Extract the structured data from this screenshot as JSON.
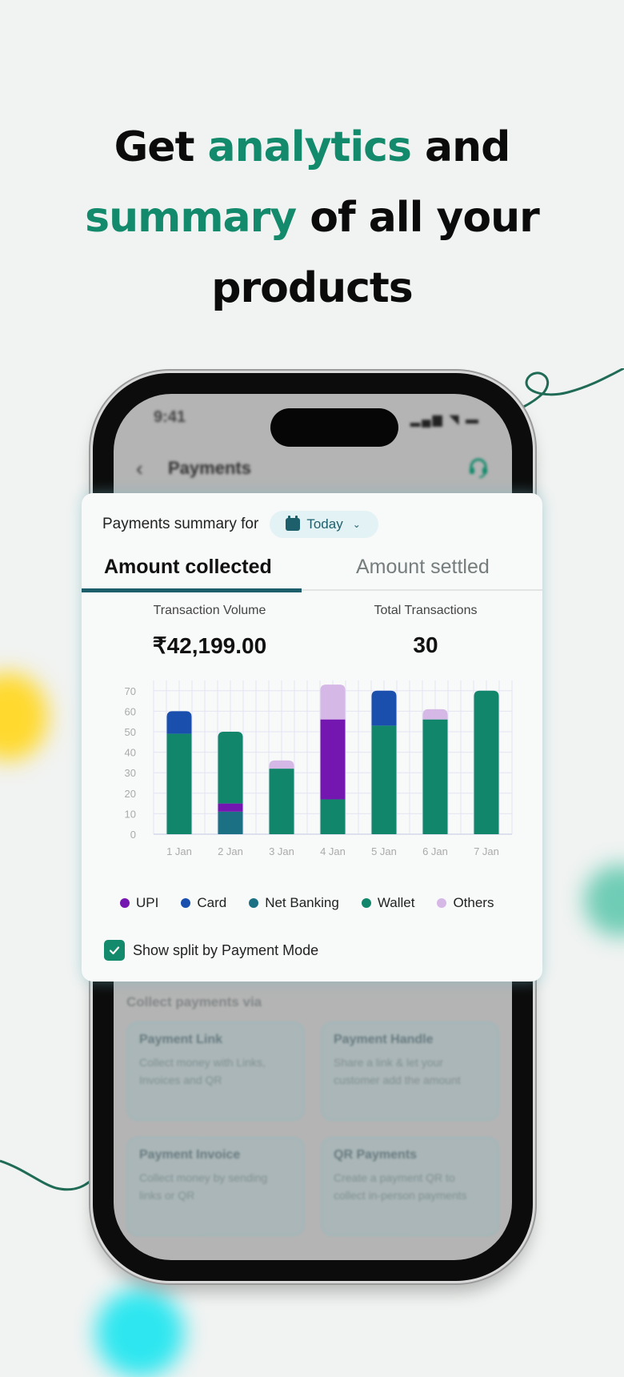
{
  "headline": {
    "line1": [
      {
        "text": "Get ",
        "accent": false
      },
      {
        "text": "analytics",
        "accent": true
      },
      {
        "text": " and",
        "accent": false
      }
    ],
    "line2": [
      {
        "text": "summary",
        "accent": true
      },
      {
        "text": " of all your",
        "accent": false
      }
    ],
    "line3": [
      {
        "text": "products",
        "accent": false
      }
    ]
  },
  "colors": {
    "accent": "#128a6b",
    "primary_dark": "#1c5f6b",
    "upi": "#7416b0",
    "card": "#1a4fae",
    "net_banking": "#1c7084",
    "wallet": "#12866a",
    "others": "#d6b8e6"
  },
  "phone": {
    "status_time": "9:41",
    "status_icons": [
      "signal-icon",
      "wifi-icon",
      "battery-icon"
    ],
    "header_title": "Payments",
    "back_icon": "chevron-left-icon",
    "support_icon": "headset-icon",
    "collect_title": "Collect payments via",
    "tiles": [
      {
        "title": "Payment Link",
        "desc": "Collect money with Links, Invoices and QR"
      },
      {
        "title": "Payment Handle",
        "desc": "Share a link & let your customer add the amount"
      },
      {
        "title": "Payment Invoice",
        "desc": "Collect money by sending links or QR"
      },
      {
        "title": "QR Payments",
        "desc": "Create a payment QR to collect in-person payments"
      }
    ]
  },
  "card": {
    "summary_label": "Payments summary for",
    "date_filter": "Today",
    "tabs": [
      {
        "label": "Amount collected",
        "active": true
      },
      {
        "label": "Amount settled",
        "active": false
      }
    ],
    "stats": {
      "volume_label": "Transaction Volume",
      "volume_value": "₹42,199.00",
      "count_label": "Total Transactions",
      "count_value": "30"
    },
    "checkbox_label": "Show split by Payment Mode",
    "checkbox_checked": true
  },
  "chart_data": {
    "type": "bar",
    "stacked": true,
    "title": "",
    "xlabel": "",
    "ylabel": "",
    "ylim": [
      0,
      70
    ],
    "yticks": [
      0,
      10,
      20,
      30,
      40,
      50,
      60,
      70
    ],
    "grid": true,
    "legend_position": "bottom",
    "categories": [
      "1 Jan",
      "2 Jan",
      "3 Jan",
      "4 Jan",
      "5 Jan",
      "6 Jan",
      "7 Jan"
    ],
    "series": [
      {
        "name": "Net Banking",
        "color": "#1c7084",
        "values": [
          0,
          11,
          0,
          0,
          0,
          0,
          0
        ]
      },
      {
        "name": "Wallet",
        "color": "#12866a",
        "values": [
          49,
          0,
          32,
          17,
          53,
          56,
          70
        ]
      },
      {
        "name": "UPI",
        "color": "#7416b0",
        "values": [
          0,
          4,
          0,
          39,
          0,
          0,
          0
        ]
      },
      {
        "name": "Wallet (upper)",
        "color": "#12866a",
        "values": [
          0,
          35,
          0,
          0,
          0,
          0,
          0
        ]
      },
      {
        "name": "Card",
        "color": "#1a4fae",
        "values": [
          11,
          0,
          0,
          0,
          17,
          0,
          0
        ]
      },
      {
        "name": "Others",
        "color": "#d6b8e6",
        "values": [
          0,
          0,
          4,
          17,
          0,
          5,
          0
        ]
      }
    ],
    "legend": [
      {
        "name": "UPI",
        "color": "#7416b0"
      },
      {
        "name": "Card",
        "color": "#1a4fae"
      },
      {
        "name": "Net Banking",
        "color": "#1c7084"
      },
      {
        "name": "Wallet",
        "color": "#12866a"
      },
      {
        "name": "Others",
        "color": "#d6b8e6"
      }
    ]
  }
}
